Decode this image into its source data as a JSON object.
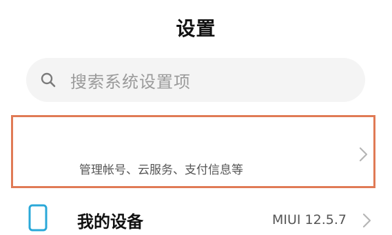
{
  "header": {
    "title": "设置"
  },
  "search": {
    "placeholder": "搜索系统设置项",
    "icon": "search-icon"
  },
  "account": {
    "subtitle": "管理帐号、云服务、支付信息等",
    "highlight_color": "#e07a55",
    "chevron_icon": "chevron-right-icon"
  },
  "device": {
    "label": "我的设备",
    "value": "MIUI 12.5.7",
    "icon": "phone-icon",
    "icon_color": "#2aa8d8",
    "chevron_icon": "chevron-right-icon"
  }
}
